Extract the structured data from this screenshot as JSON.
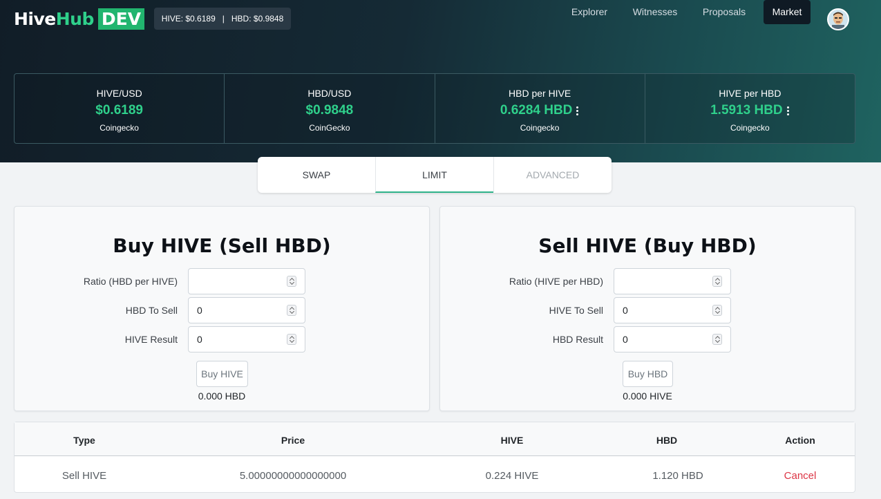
{
  "brand": {
    "logo_hive": "Hive",
    "logo_hub": "Hub",
    "logo_dev": "DEV"
  },
  "ticker": {
    "hive": "HIVE: $0.6189",
    "sep": "|",
    "hbd": "HBD: $0.9848"
  },
  "nav": {
    "items": [
      "Explorer",
      "Witnesses",
      "Proposals",
      "Market"
    ],
    "active": "Market"
  },
  "stats": [
    {
      "label": "HIVE/USD",
      "value": "$0.6189",
      "source": "Coingecko",
      "menu": false
    },
    {
      "label": "HBD/USD",
      "value": "$0.9848",
      "source": "CoinGecko",
      "menu": false
    },
    {
      "label": "HBD per HIVE",
      "value": "0.6284 HBD",
      "source": "Coingecko",
      "menu": true
    },
    {
      "label": "HIVE per HBD",
      "value": "1.5913 HBD",
      "source": "Coingecko",
      "menu": true
    }
  ],
  "tabs": [
    {
      "label": "SWAP",
      "state": "normal"
    },
    {
      "label": "LIMIT",
      "state": "active"
    },
    {
      "label": "ADVANCED",
      "state": "disabled"
    }
  ],
  "buy": {
    "title": "Buy HIVE (Sell HBD)",
    "fields": [
      {
        "label": "Ratio (HBD per HIVE)",
        "value": ""
      },
      {
        "label": "HBD To Sell",
        "value": "0"
      },
      {
        "label": "HIVE Result",
        "value": "0"
      }
    ],
    "button": "Buy HIVE",
    "balance": "0.000 HBD"
  },
  "sell": {
    "title": "Sell HIVE (Buy HBD)",
    "fields": [
      {
        "label": "Ratio (HIVE per HBD)",
        "value": ""
      },
      {
        "label": "HIVE To Sell",
        "value": "0"
      },
      {
        "label": "HBD Result",
        "value": "0"
      }
    ],
    "button": "Buy HBD",
    "balance": "0.000 HIVE"
  },
  "orders": {
    "headers": [
      "Type",
      "Price",
      "HIVE",
      "HBD",
      "Action"
    ],
    "rows": [
      {
        "type": "Sell HIVE",
        "price": "5.00000000000000000",
        "hive": "0.224 HIVE",
        "hbd": "1.120 HBD",
        "action": "Cancel"
      }
    ]
  },
  "colors": {
    "accent": "#2fd08b",
    "danger": "#dc3545",
    "nav_active": "#0f1a24"
  }
}
